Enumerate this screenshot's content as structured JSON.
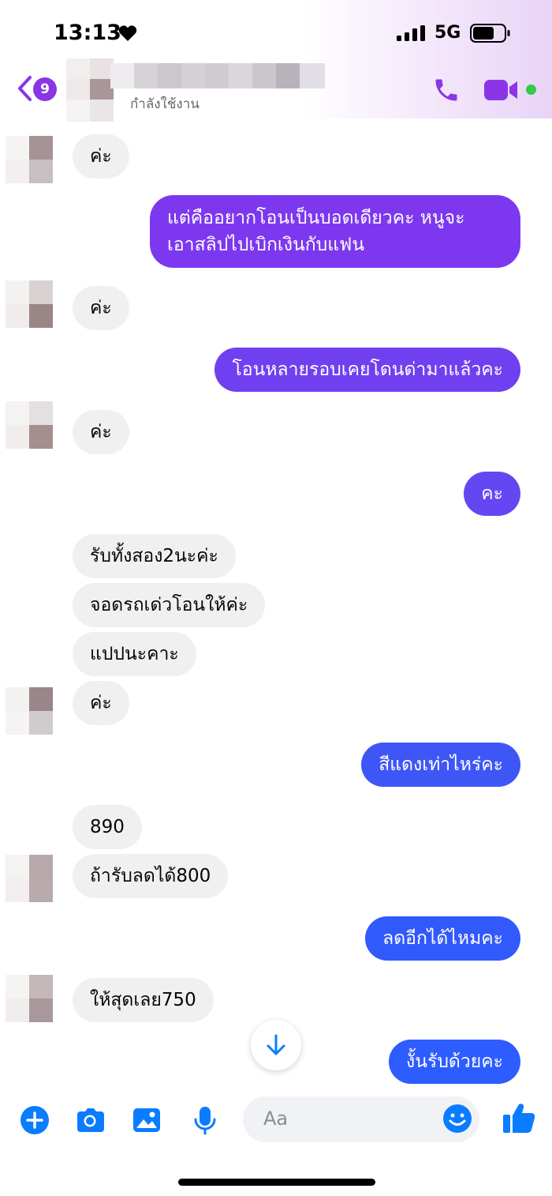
{
  "status_bar": {
    "time": "13:13",
    "network": "5G"
  },
  "header": {
    "back_badge": "9",
    "contact_status": "กำลังใช้งาน"
  },
  "messages": [
    {
      "side": "in",
      "text": "ค่ะ"
    },
    {
      "side": "out",
      "text": "แต่คืออยากโอนเป็นบอดเดียวคะ หนูจะ",
      "text2": "เอาสลิปไปเบิกเงินกับแฟน"
    },
    {
      "side": "in",
      "text": "ค่ะ"
    },
    {
      "side": "out",
      "text": "โอนหลายรอบเคยโดนด่ามาแล้วคะ"
    },
    {
      "side": "in",
      "text": "ค่ะ"
    },
    {
      "side": "out",
      "text": "คะ"
    },
    {
      "side": "in",
      "text": "รับทั้งสอง2นะค่ะ"
    },
    {
      "side": "in",
      "text": "จอดรถเด่วโอนให้ค่ะ"
    },
    {
      "side": "in",
      "text": "แปปนะคาะ"
    },
    {
      "side": "in",
      "text": "ค่ะ"
    },
    {
      "side": "out",
      "text": "สีแดงเท่าไหร่คะ"
    },
    {
      "side": "in",
      "text": "890"
    },
    {
      "side": "in",
      "text": "ถ้ารับลดได้800"
    },
    {
      "side": "out",
      "text": "ลดอีกได้ไหมคะ"
    },
    {
      "side": "in",
      "text": "ให้สุดเลย750"
    },
    {
      "side": "out",
      "text": "งั้นรับด้วยคะ"
    }
  ],
  "composer": {
    "placeholder": "Aa"
  },
  "colors": {
    "accent_purple": "#8a35e6",
    "bubble_purple": "#7b3ef0",
    "bubble_blue": "#2f5dff",
    "incoming_bg": "#f0f0f0",
    "icon_blue": "#0a7cff"
  }
}
